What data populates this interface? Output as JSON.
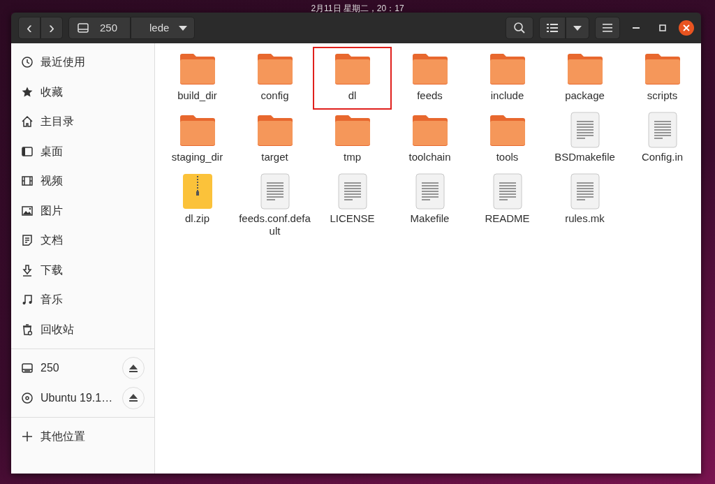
{
  "top_bar": {
    "clock": "2月11日 星期二，20：17"
  },
  "header": {
    "back_button": "‹",
    "forward_button": "›",
    "path": [
      {
        "label": "250",
        "kind": "drive"
      },
      {
        "label": "lede",
        "kind": "folder"
      }
    ]
  },
  "sidebar": {
    "sections": [
      {
        "items": [
          {
            "label": "最近使用",
            "kind": "recent"
          },
          {
            "label": "收藏",
            "kind": "star"
          },
          {
            "label": "主目录",
            "kind": "home"
          },
          {
            "label": "桌面",
            "kind": "desktop"
          },
          {
            "label": "视频",
            "kind": "video"
          },
          {
            "label": "图片",
            "kind": "image"
          },
          {
            "label": "文档",
            "kind": "document"
          },
          {
            "label": "下载",
            "kind": "download"
          },
          {
            "label": "音乐",
            "kind": "music"
          },
          {
            "label": "回收站",
            "kind": "trash"
          }
        ]
      },
      {
        "items": [
          {
            "label": "250",
            "kind": "drive",
            "ejectable": true
          },
          {
            "label": "Ubuntu 19.1…",
            "kind": "disc",
            "ejectable": true
          }
        ]
      },
      {
        "items": [
          {
            "label": "其他位置",
            "kind": "other"
          }
        ]
      }
    ]
  },
  "files": [
    {
      "name": "build_dir",
      "kind": "folder",
      "highlighted": false
    },
    {
      "name": "config",
      "kind": "folder",
      "highlighted": false
    },
    {
      "name": "dl",
      "kind": "folder",
      "highlighted": true
    },
    {
      "name": "feeds",
      "kind": "folder",
      "highlighted": false
    },
    {
      "name": "include",
      "kind": "folder",
      "highlighted": false
    },
    {
      "name": "package",
      "kind": "folder",
      "highlighted": false
    },
    {
      "name": "scripts",
      "kind": "folder",
      "highlighted": false
    },
    {
      "name": "staging_dir",
      "kind": "folder",
      "highlighted": false
    },
    {
      "name": "target",
      "kind": "folder",
      "highlighted": false
    },
    {
      "name": "tmp",
      "kind": "folder",
      "highlighted": false
    },
    {
      "name": "toolchain",
      "kind": "folder",
      "highlighted": false
    },
    {
      "name": "tools",
      "kind": "folder",
      "highlighted": false
    },
    {
      "name": "BSDmakefile",
      "kind": "text",
      "highlighted": false
    },
    {
      "name": "Config.in",
      "kind": "text",
      "highlighted": false
    },
    {
      "name": "dl.zip",
      "kind": "archive",
      "highlighted": false
    },
    {
      "name": "feeds.conf.default",
      "kind": "text",
      "highlighted": false
    },
    {
      "name": "LICENSE",
      "kind": "text",
      "highlighted": false
    },
    {
      "name": "Makefile",
      "kind": "text",
      "highlighted": false
    },
    {
      "name": "README",
      "kind": "text",
      "highlighted": false
    },
    {
      "name": "rules.mk",
      "kind": "text",
      "highlighted": false
    }
  ]
}
